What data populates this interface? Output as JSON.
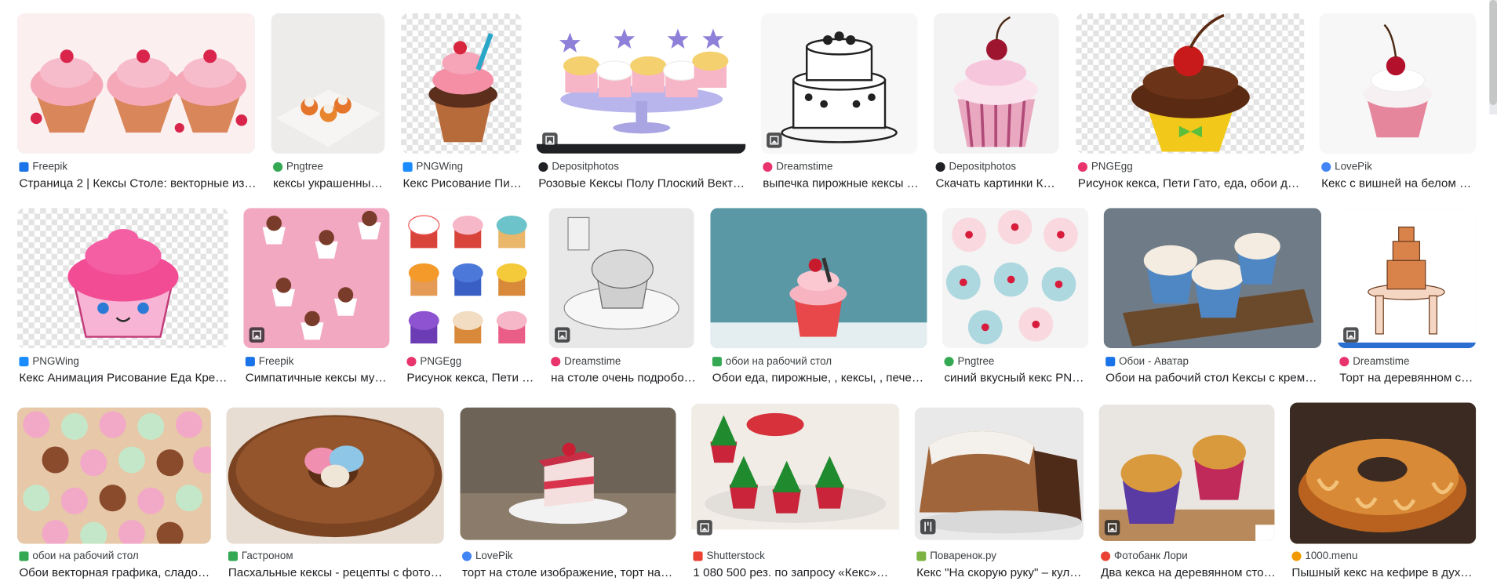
{
  "rows": [
    {
      "cards": [
        {
          "source": "Freepik",
          "title": "Страница 2 | Кексы Столе: векторные из…",
          "icon": "freepik-icon",
          "color": "#1a73e8"
        },
        {
          "source": "Pngtree",
          "title": "кексы украшенны…",
          "icon": "pngtree-icon",
          "color": "#34a853"
        },
        {
          "source": "PNGWing",
          "title": "Кекс Рисование Пи…",
          "icon": "pngwing-icon",
          "color": "#1a8cff"
        },
        {
          "source": "Depositphotos",
          "title": "Розовые Кексы Полу Плоский Векто…",
          "icon": "depositphotos-icon",
          "color": "#202124"
        },
        {
          "source": "Dreamstime",
          "title": "выпечка пирожные кексы …",
          "icon": "dreamstime-icon",
          "color": "#e8336d"
        },
        {
          "source": "Depositphotos",
          "title": "Скачать картинки К…",
          "icon": "depositphotos-icon",
          "color": "#202124"
        },
        {
          "source": "PNGEgg",
          "title": "Рисунок кекса, Пети Гато, еда, обои дл…",
          "icon": "pngegg-icon",
          "color": "#e8336d"
        },
        {
          "source": "LovePik",
          "title": "Кекс с вишней на белом …",
          "icon": "lovepik-icon",
          "color": "#4285f4"
        }
      ]
    },
    {
      "cards": [
        {
          "source": "PNGWing",
          "title": "Кекс Анимация Рисование Еда Кре…",
          "icon": "pngwing-icon",
          "color": "#1a8cff"
        },
        {
          "source": "Freepik",
          "title": "Симпатичные кексы му…",
          "icon": "freepik-icon",
          "color": "#1a73e8"
        },
        {
          "source": "PNGEgg",
          "title": "Рисунок кекса, Пети …",
          "icon": "pngegg-icon",
          "color": "#e8336d"
        },
        {
          "source": "Dreamstime",
          "title": "на столе очень подробо…",
          "icon": "dreamstime-icon",
          "color": "#e8336d"
        },
        {
          "source": "обои на рабочий стол",
          "title": "Обои еда, пирожные, , кексы, , печен…",
          "icon": "wallpaper-icon",
          "color": "#34a853"
        },
        {
          "source": "Pngtree",
          "title": "синий вкусный кекс PN…",
          "icon": "pngtree-icon",
          "color": "#34a853"
        },
        {
          "source": "Обои - Аватар",
          "title": "Обои на рабочий стол Кексы с кремо…",
          "icon": "avatar-icon",
          "color": "#1a73e8"
        },
        {
          "source": "Dreamstime",
          "title": "Торт на деревянном с…",
          "icon": "dreamstime-icon",
          "color": "#e8336d"
        }
      ]
    },
    {
      "cards": [
        {
          "source": "обои на рабочий стол",
          "title": "Обои векторная графика, сладо…",
          "icon": "wallpaper-icon",
          "color": "#34a853"
        },
        {
          "source": "Гастроном",
          "title": "Пасхальные кексы - рецепты с фото…",
          "icon": "gastronom-icon",
          "color": "#34a853"
        },
        {
          "source": "LovePik",
          "title": "торт на столе изображение, торт на…",
          "icon": "lovepik-icon",
          "color": "#4285f4"
        },
        {
          "source": "Shutterstock",
          "title": "1 080 500 рез. по запросу «Кекс»…",
          "icon": "shutterstock-icon",
          "color": "#ea4335"
        },
        {
          "source": "Поваренок.ру",
          "title": "Кекс \"На скорую руку\" – кул…",
          "icon": "povarenok-icon",
          "color": "#7cb342"
        },
        {
          "source": "Фотобанк Лори",
          "title": "Два кекса на деревянном сто…",
          "icon": "lori-icon",
          "color": "#ea4335"
        },
        {
          "source": "1000.menu",
          "title": "Пышный кекс на кефире в духо…",
          "icon": "menu-icon",
          "color": "#f29900"
        }
      ]
    }
  ]
}
